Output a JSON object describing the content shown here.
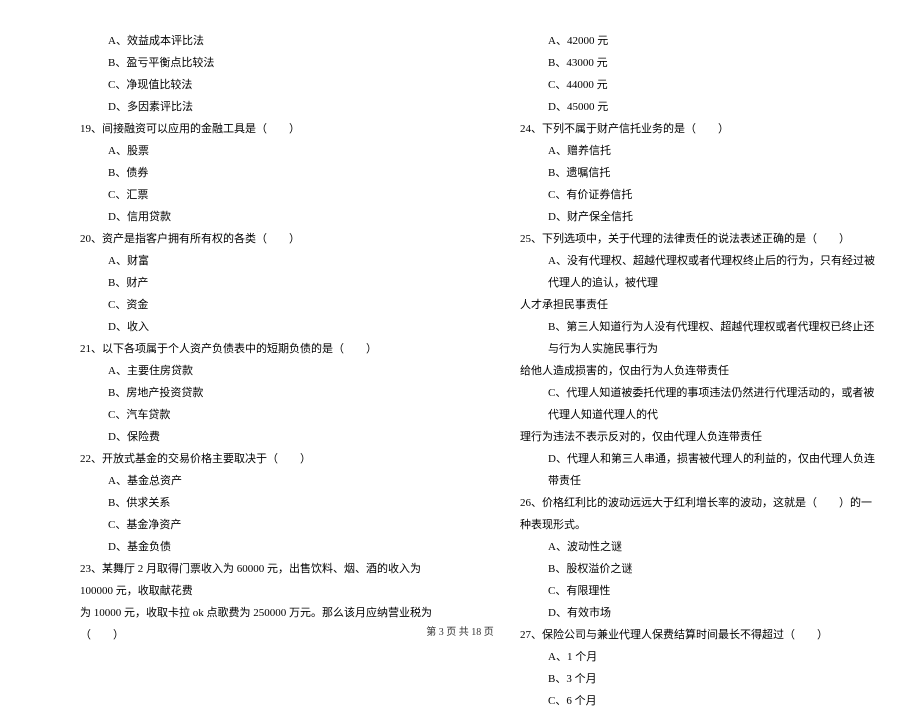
{
  "left": {
    "pre_options": [
      "A、效益成本评比法",
      "B、盈亏平衡点比较法",
      "C、净现值比较法",
      "D、多因素评比法"
    ],
    "q19": {
      "stem": "19、间接融资可以应用的金融工具是（　　）",
      "options": [
        "A、股票",
        "B、债券",
        "C、汇票",
        "D、信用贷款"
      ]
    },
    "q20": {
      "stem": "20、资产是指客户拥有所有权的各类（　　）",
      "options": [
        "A、财富",
        "B、财产",
        "C、资金",
        "D、收入"
      ]
    },
    "q21": {
      "stem": "21、以下各项属于个人资产负债表中的短期负债的是（　　）",
      "options": [
        "A、主要住房贷款",
        "B、房地产投资贷款",
        "C、汽车贷款",
        "D、保险费"
      ]
    },
    "q22": {
      "stem": "22、开放式基金的交易价格主要取决于（　　）",
      "options": [
        "A、基金总资产",
        "B、供求关系",
        "C、基金净资产",
        "D、基金负债"
      ]
    },
    "q23": {
      "line1": "23、某舞厅 2 月取得门票收入为 60000 元，出售饮料、烟、酒的收入为 100000 元，收取献花费",
      "line2": "为 10000 元，收取卡拉 ok 点歌费为 250000 万元。那么该月应纳营业税为（　　）"
    }
  },
  "right": {
    "pre_options": [
      "A、42000 元",
      "B、43000 元",
      "C、44000 元",
      "D、45000 元"
    ],
    "q24": {
      "stem": "24、下列不属于财产信托业务的是（　　）",
      "options": [
        "A、赠养信托",
        "B、遗嘱信托",
        "C、有价证券信托",
        "D、财产保全信托"
      ]
    },
    "q25": {
      "stem": "25、下列选项中，关于代理的法律责任的说法表述正确的是（　　）",
      "a1": "A、没有代理权、超越代理权或者代理权终止后的行为，只有经过被代理人的追认，被代理",
      "a2": "人才承担民事责任",
      "b1": "B、第三人知道行为人没有代理权、超越代理权或者代理权已终止还与行为人实施民事行为",
      "b2": "给他人造成损害的，仅由行为人负连带责任",
      "c1": "C、代理人知道被委托代理的事项违法仍然进行代理活动的，或者被代理人知道代理人的代",
      "c2": "理行为违法不表示反对的，仅由代理人负连带责任",
      "d": "D、代理人和第三人串通，损害被代理人的利益的，仅由代理人负连带责任"
    },
    "q26": {
      "stem": "26、价格红利比的波动远远大于红利增长率的波动，这就是（　　）的一种表现形式。",
      "options": [
        "A、波动性之谜",
        "B、股权溢价之谜",
        "C、有限理性",
        "D、有效市场"
      ]
    },
    "q27": {
      "stem": "27、保险公司与兼业代理人保费结算时间最长不得超过（　　）",
      "options": [
        "A、1 个月",
        "B、3 个月",
        "C、6 个月"
      ]
    }
  },
  "footer": "第 3 页 共 18 页"
}
